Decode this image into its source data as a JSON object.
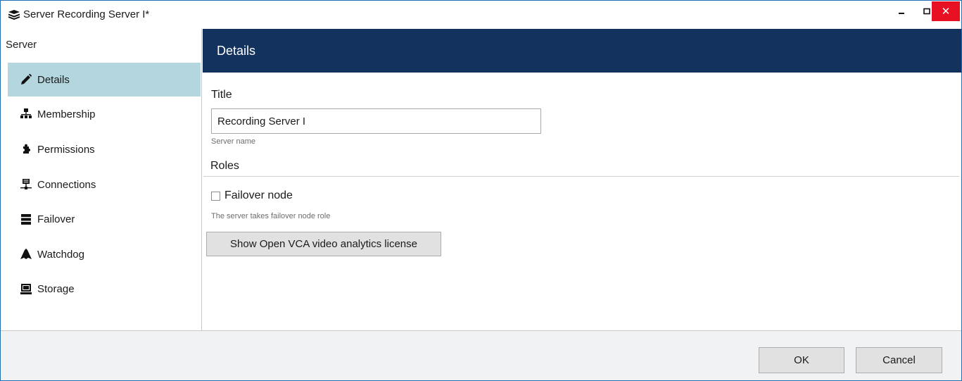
{
  "window": {
    "title": "Server Recording Server I*",
    "minimize_glyph": "▁",
    "maximize_glyph": "□",
    "close_glyph": "✕",
    "close_color": "#e81123",
    "icon": "server-stack-icon"
  },
  "sidebar": {
    "header": "Server",
    "selected_color": "#b4d6de",
    "items": [
      {
        "label": "Details",
        "icon": "pencil-icon",
        "selected": true
      },
      {
        "label": "Membership",
        "icon": "hierarchy-icon",
        "selected": false
      },
      {
        "label": "Permissions",
        "icon": "puzzle-icon",
        "selected": false
      },
      {
        "label": "Connections",
        "icon": "network-icon",
        "selected": false
      },
      {
        "label": "Failover",
        "icon": "server-rack-icon",
        "selected": false
      },
      {
        "label": "Watchdog",
        "icon": "dog-icon",
        "selected": false
      },
      {
        "label": "Storage",
        "icon": "hard-drive-icon",
        "selected": false
      }
    ]
  },
  "details": {
    "header_title": "Details",
    "header_color": "#13325e",
    "title_label": "Title",
    "title_value": "Recording Server I",
    "title_hint": "Server name",
    "roles_label": "Roles",
    "failover_checkbox_label": "Failover node",
    "failover_checked": false,
    "failover_hint": "The server takes failover node role",
    "license_button_label": "Show Open VCA video analytics license"
  },
  "footer": {
    "ok_label": "OK",
    "cancel_label": "Cancel"
  }
}
